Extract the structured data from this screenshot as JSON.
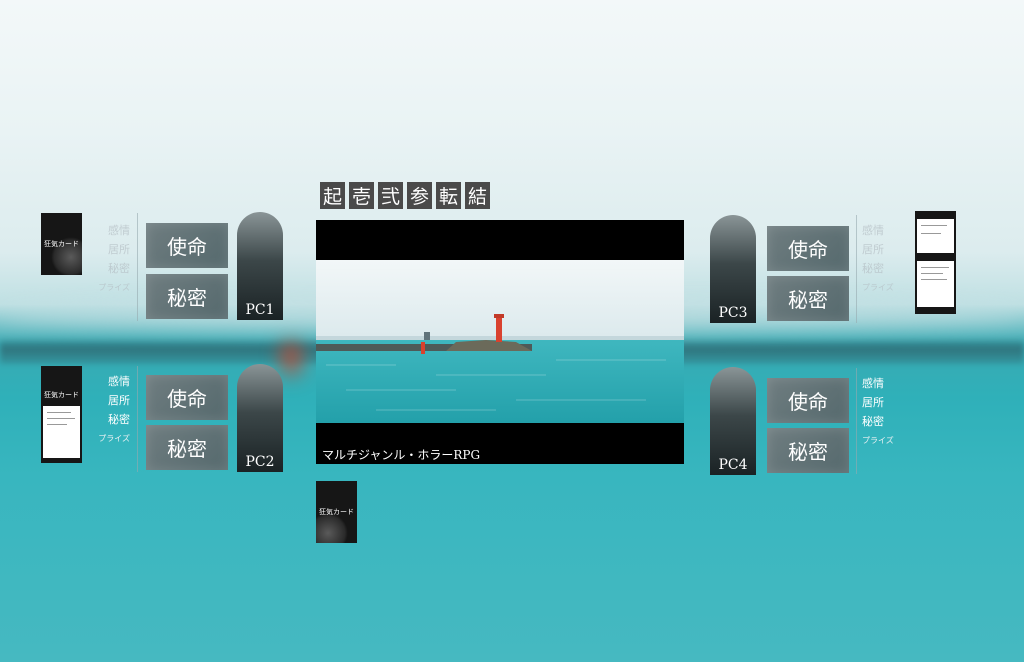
{
  "title_chars": [
    "起",
    "壱",
    "弐",
    "参",
    "転",
    "結"
  ],
  "banner": {
    "caption": "マルチジャンル・ホラーRPG"
  },
  "card_label": "狂気カード",
  "tiles": {
    "mission": "使命",
    "secret": "秘密"
  },
  "stats": {
    "emotion": "感情",
    "location": "居所",
    "secret": "秘密",
    "prize": "プライズ"
  },
  "players": {
    "pc1": {
      "label": "PC1"
    },
    "pc2": {
      "label": "PC2"
    },
    "pc3": {
      "label": "PC3"
    },
    "pc4": {
      "label": "PC4"
    }
  },
  "colors": {
    "sea": "#2fb0b9",
    "sky": "#e9f3f4",
    "panel": "#5f7175",
    "lighthouse": "#d9412e"
  }
}
